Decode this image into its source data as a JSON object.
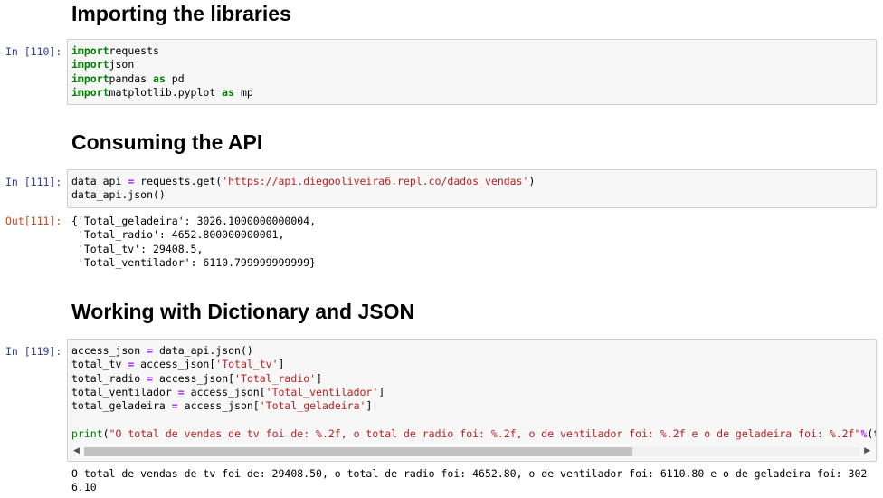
{
  "headings": {
    "importing": "Importing the libraries",
    "consuming": "Consuming the API",
    "working": "Working with Dictionary and JSON"
  },
  "cells": [
    {
      "prompt": "In [110]:",
      "lines": [
        [
          [
            "kw",
            "import"
          ],
          [
            "",
            "requests"
          ]
        ],
        [
          [
            "kw",
            "import"
          ],
          [
            "",
            "json"
          ]
        ],
        [
          [
            "kw",
            "import"
          ],
          [
            "",
            "pandas "
          ],
          [
            "kw",
            "as"
          ],
          [
            "",
            " pd"
          ]
        ],
        [
          [
            "kw",
            "import"
          ],
          [
            "",
            "matplotlib.pyplot "
          ],
          [
            "kw",
            "as"
          ],
          [
            "",
            " mp"
          ]
        ]
      ]
    },
    {
      "prompt": "In [111]:",
      "lines": [
        [
          [
            "",
            "data_api "
          ],
          [
            "op",
            "="
          ],
          [
            "",
            " requests.get("
          ],
          [
            "str",
            "'https://api.diegooliveira6.repl.co/dados_vendas'"
          ],
          [
            "",
            ")"
          ]
        ],
        [
          [
            "",
            "data_api.json()"
          ]
        ]
      ]
    },
    {
      "prompt": "In [119]:",
      "lines": [
        [
          [
            "",
            "access_json "
          ],
          [
            "op",
            "="
          ],
          [
            "",
            " data_api.json()"
          ]
        ],
        [
          [
            "",
            "total_tv "
          ],
          [
            "op",
            "="
          ],
          [
            "",
            " access_json["
          ],
          [
            "str",
            "'Total_tv'"
          ],
          [
            "",
            "]"
          ]
        ],
        [
          [
            "",
            "total_radio "
          ],
          [
            "op",
            "="
          ],
          [
            "",
            " access_json["
          ],
          [
            "str",
            "'Total_radio'"
          ],
          [
            "",
            "]"
          ]
        ],
        [
          [
            "",
            "total_ventilador "
          ],
          [
            "op",
            "="
          ],
          [
            "",
            " access_json["
          ],
          [
            "str",
            "'Total_ventilador'"
          ],
          [
            "",
            "]"
          ]
        ],
        [
          [
            "",
            "total_geladeira "
          ],
          [
            "op",
            "="
          ],
          [
            "",
            " access_json["
          ],
          [
            "str",
            "'Total_geladeira'"
          ],
          [
            "",
            "]"
          ]
        ],
        [
          [
            "",
            ""
          ]
        ],
        [
          [
            "bi",
            "print"
          ],
          [
            "",
            "("
          ],
          [
            "str",
            "\"O total de vendas de tv foi de: %.2f, o total de radio foi: %.2f, o de ventilador foi: %.2f e o de geladeira foi: %.2f\""
          ],
          [
            "op",
            "%"
          ],
          [
            "",
            "(t"
          ]
        ]
      ]
    }
  ],
  "outputs": {
    "out111_prompt": "Out[111]:",
    "out111_text": "{'Total_geladeira': 3026.1000000000004,\n 'Total_radio': 4652.800000000001,\n 'Total_tv': 29408.5,\n 'Total_ventilador': 6110.799999999999}",
    "out119_text": "O total de vendas de tv foi de: 29408.50, o total de radio foi: 4652.80, o de ventilador foi: 6110.80 e o de geladeira foi: 302\n6.10"
  },
  "scrollbar": {
    "left_arrow_icon": "arrow-left-icon",
    "right_arrow_icon": "arrow-right-icon",
    "left_arrow": "◀",
    "right_arrow": "▶"
  }
}
